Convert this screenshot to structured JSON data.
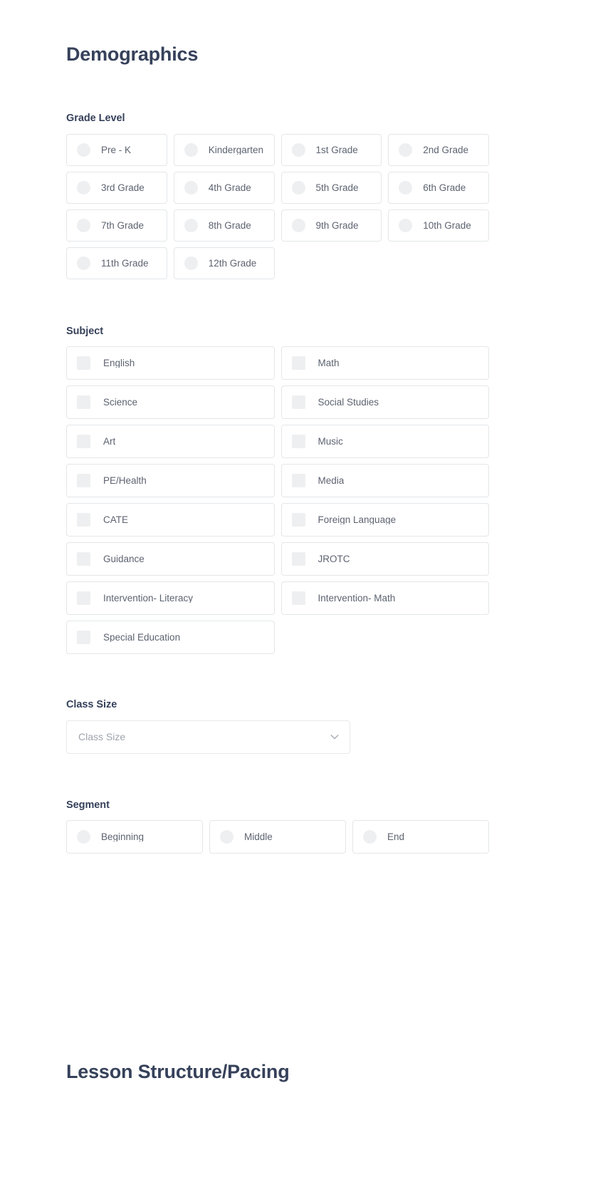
{
  "page": {
    "section_title": "Demographics",
    "footer_section_title": "Lesson Structure/Pacing",
    "accent_heading_color": "#36415a",
    "label_color": "#5c6370",
    "card_border_color": "#e4e6e9",
    "control_fill_color": "#eeeff1",
    "placeholder_color": "#9ea4ad"
  },
  "grade_level": {
    "label": "Grade Level",
    "control_type": "radio",
    "options": [
      {
        "label": "Pre - K",
        "selected": false
      },
      {
        "label": "Kindergarten",
        "selected": false
      },
      {
        "label": "1st Grade",
        "selected": false
      },
      {
        "label": "2nd Grade",
        "selected": false
      },
      {
        "label": "3rd Grade",
        "selected": false
      },
      {
        "label": "4th Grade",
        "selected": false
      },
      {
        "label": "5th Grade",
        "selected": false
      },
      {
        "label": "6th Grade",
        "selected": false
      },
      {
        "label": "7th Grade",
        "selected": false
      },
      {
        "label": "8th Grade",
        "selected": false
      },
      {
        "label": "9th Grade",
        "selected": false
      },
      {
        "label": "10th Grade",
        "selected": false
      },
      {
        "label": "11th Grade",
        "selected": false
      },
      {
        "label": "12th Grade",
        "selected": false
      }
    ]
  },
  "subject": {
    "label": "Subject",
    "control_type": "checkbox",
    "options": [
      {
        "label": "English",
        "checked": false
      },
      {
        "label": "Math",
        "checked": false
      },
      {
        "label": "Science",
        "checked": false
      },
      {
        "label": "Social Studies",
        "checked": false
      },
      {
        "label": "Art",
        "checked": false
      },
      {
        "label": "Music",
        "checked": false
      },
      {
        "label": "PE/Health",
        "checked": false
      },
      {
        "label": "Media",
        "checked": false
      },
      {
        "label": "CATE",
        "checked": false
      },
      {
        "label": "Foreign Language",
        "checked": false
      },
      {
        "label": "Guidance",
        "checked": false
      },
      {
        "label": "JROTC",
        "checked": false
      },
      {
        "label": "Intervention- Literacy",
        "checked": false
      },
      {
        "label": "Intervention- Math",
        "checked": false
      },
      {
        "label": "Special Education",
        "checked": false
      }
    ]
  },
  "class_size": {
    "label": "Class Size",
    "control_type": "select",
    "placeholder": "Class Size",
    "value": "",
    "icon": "chevron-down-icon"
  },
  "segment": {
    "label": "Segment",
    "control_type": "radio",
    "options": [
      {
        "label": "Beginning",
        "selected": false
      },
      {
        "label": "Middle",
        "selected": false
      },
      {
        "label": "End",
        "selected": false
      }
    ]
  }
}
